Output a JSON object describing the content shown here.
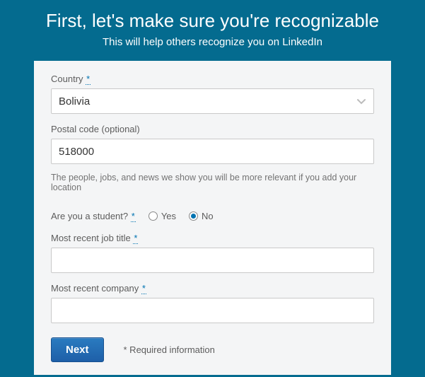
{
  "header": {
    "title": "First, let's make sure you're recognizable",
    "subtitle": "This will help others recognize you on LinkedIn"
  },
  "form": {
    "country": {
      "label": "Country",
      "value": "Bolivia",
      "required_marker": "*"
    },
    "postal": {
      "label": "Postal code (optional)",
      "value": "518000"
    },
    "location_helper": "The people, jobs, and news we show you will be more relevant if you add your location",
    "student": {
      "label": "Are you a student?",
      "required_marker": "*",
      "options": {
        "yes": "Yes",
        "no": "No"
      },
      "selected": "no"
    },
    "job_title": {
      "label": "Most recent job title",
      "required_marker": "*",
      "value": ""
    },
    "company": {
      "label": "Most recent company",
      "required_marker": "*",
      "value": ""
    },
    "next_button": "Next",
    "required_note": "* Required information"
  }
}
